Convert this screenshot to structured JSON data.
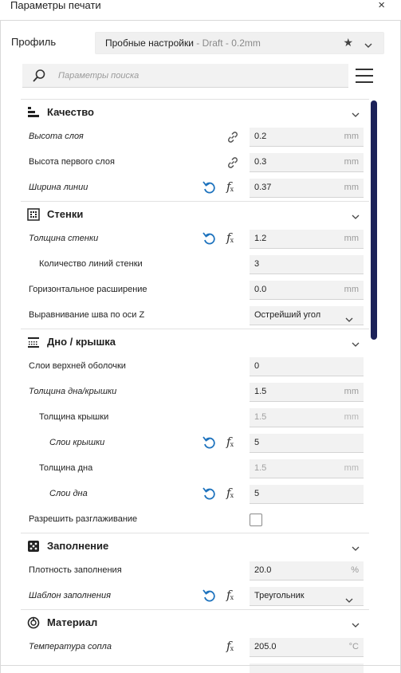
{
  "window": {
    "title": "Параметры печати",
    "close_glyph": "×"
  },
  "profile": {
    "label": "Профиль",
    "name": "Пробные настройки",
    "sub": " - Draft - 0.2mm",
    "star_icon": "star-icon",
    "chevron_icon": "chevron-down-icon"
  },
  "search": {
    "placeholder": "Параметры поиска",
    "icon": "search-icon"
  },
  "menu_icon": "hamburger-menu-icon",
  "colors": {
    "accent": "#1c2259",
    "reset_blue": "#1e73be",
    "field_bg": "#f2f2f2"
  },
  "sections": {
    "quality": {
      "title": "Качество",
      "icon": "quality-icon",
      "rows": {
        "layer_height": {
          "label": "Высота слоя",
          "value": "0.2",
          "unit": "mm"
        },
        "first_layer_height": {
          "label": "Высота первого слоя",
          "value": "0.3",
          "unit": "mm"
        },
        "line_width": {
          "label": "Ширина линии",
          "value": "0.37",
          "unit": "mm"
        }
      }
    },
    "walls": {
      "title": "Стенки",
      "icon": "walls-icon",
      "rows": {
        "wall_thickness": {
          "label": "Толщина стенки",
          "value": "1.2",
          "unit": "mm"
        },
        "wall_line_count": {
          "label": "Количество линий стенки",
          "value": "3"
        },
        "horizontal_expansion": {
          "label": "Горизонтальное расширение",
          "value": "0.0",
          "unit": "mm"
        },
        "z_seam_alignment": {
          "label": "Выравнивание шва по оси Z",
          "value": "Острейший угол"
        }
      }
    },
    "top_bottom": {
      "title": "Дно / крышка",
      "icon": "top-bottom-icon",
      "rows": {
        "top_surface_skin_layers": {
          "label": "Слои верхней оболочки",
          "value": "0"
        },
        "top_bottom_thickness": {
          "label": "Толщина дна/крышки",
          "value": "1.5",
          "unit": "mm"
        },
        "top_thickness": {
          "label": "Толщина крышки",
          "value": "1.5",
          "unit": "mm"
        },
        "top_layers": {
          "label": "Слои крышки",
          "value": "5"
        },
        "bottom_thickness": {
          "label": "Толщина дна",
          "value": "1.5",
          "unit": "mm"
        },
        "bottom_layers": {
          "label": "Слои дна",
          "value": "5"
        },
        "enable_ironing": {
          "label": "Разрешить разглаживание",
          "checked": false
        }
      }
    },
    "infill": {
      "title": "Заполнение",
      "icon": "infill-icon",
      "rows": {
        "infill_density": {
          "label": "Плотность заполнения",
          "value": "20.0",
          "unit": "%"
        },
        "infill_pattern": {
          "label": "Шаблон заполнения",
          "value": "Треугольник"
        }
      }
    },
    "material": {
      "title": "Материал",
      "icon": "material-icon",
      "rows": {
        "nozzle_temperature": {
          "label": "Температура сопла",
          "value": "205.0",
          "unit": "°C"
        }
      }
    }
  }
}
